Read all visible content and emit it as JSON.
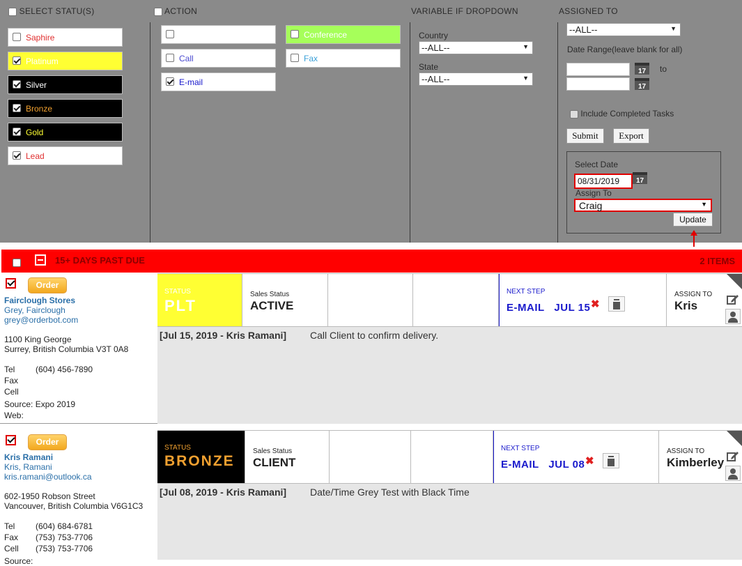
{
  "filters": {
    "status": {
      "header": "SELECT STATU(S)",
      "items": [
        {
          "label": "Saphire",
          "checked": false,
          "bg": "#ffffff",
          "color": "#e03030"
        },
        {
          "label": "Platinum",
          "checked": true,
          "bg": "#ffff33",
          "color": "#ffffff"
        },
        {
          "label": "Silver",
          "checked": true,
          "bg": "#000000",
          "color": "#ffffff"
        },
        {
          "label": "Bronze",
          "checked": true,
          "bg": "#000000",
          "color": "#f0a030"
        },
        {
          "label": "Gold",
          "checked": true,
          "bg": "#000000",
          "color": "#ffff33"
        },
        {
          "label": "Lead",
          "checked": true,
          "bg": "#ffffff",
          "color": "#e03030"
        }
      ]
    },
    "action": {
      "header": "ACTION",
      "items": [
        {
          "label": "",
          "checked": false
        },
        {
          "label": "Call",
          "checked": false
        },
        {
          "label": "E-mail",
          "checked": true
        },
        {
          "label": "Conference",
          "checked": false
        },
        {
          "label": "Fax",
          "checked": false
        }
      ]
    },
    "variable": {
      "header": "VARIABLE IF DROPDOWN",
      "country_label": "Country",
      "country_value": "--ALL--",
      "state_label": "State",
      "state_value": "--ALL--"
    },
    "assigned": {
      "header": "ASSIGNED TO",
      "value": "--ALL--",
      "date_range_label": "Date Range(leave blank for all)",
      "to_label": "to",
      "calendar_day": "17",
      "include_completed_label": "Include Completed Tasks",
      "submit_label": "Submit",
      "export_label": "Export"
    },
    "update_box": {
      "select_date_label": "Select Date",
      "date_value": "08/31/2019",
      "assign_to_label": "Assign To",
      "assign_value": "Craig",
      "update_label": "Update"
    }
  },
  "group": {
    "title": "15+ DAYS PAST DUE",
    "count": "2 ITEMS"
  },
  "records": [
    {
      "order_label": "Order",
      "company": "Fairclough Stores",
      "contact": "Grey, Fairclough",
      "email": "grey@orderbot.com",
      "address1": "1100 King George",
      "address2": "Surrey, British Columbia V3T 0A8",
      "tel_label": "Tel",
      "tel": "(604) 456-7890",
      "fax_label": "Fax",
      "fax": "",
      "cell_label": "Cell",
      "cell": "",
      "source": "Source: Expo 2019",
      "web": "Web:",
      "status_label": "STATUS",
      "status_value": "PLT",
      "status_bg": "#ffff33",
      "status_color": "#ffffff",
      "sales_status_label": "Sales Status",
      "sales_status": "ACTIVE",
      "next_step_label": "NEXT STEP",
      "next_step": "E-MAIL   JUL 15",
      "assign_label": "ASSIGN TO",
      "assign": "Kris",
      "note_date": "[Jul 15, 2019 - Kris Ramani]",
      "note_text": "Call Client to confirm delivery."
    },
    {
      "order_label": "Order",
      "company": "Kris Ramani",
      "contact": "Kris, Ramani",
      "email": "kris.ramani@outlook.ca",
      "address1": "602-1950 Robson Street",
      "address2": "Vancouver, British Columbia V6G1C3",
      "tel_label": "Tel",
      "tel": "(604) 684-6781",
      "fax_label": "Fax",
      "fax": "(753) 753-7706",
      "cell_label": "Cell",
      "cell": "(753) 753-7706",
      "source": "Source:",
      "web": "",
      "status_label": "STATUS",
      "status_value": "BRONZE",
      "status_bg": "#000000",
      "status_color": "#f0a030",
      "sales_status_label": "Sales Status",
      "sales_status": "CLIENT",
      "next_step_label": "NEXT STEP",
      "next_step": "E-MAIL   JUL 08",
      "assign_label": "ASSIGN TO",
      "assign": "Kimberley",
      "note_date": "[Jul 08, 2019 - Kris Ramani]",
      "note_text": "Date/Time Grey Test with Black Time"
    }
  ]
}
